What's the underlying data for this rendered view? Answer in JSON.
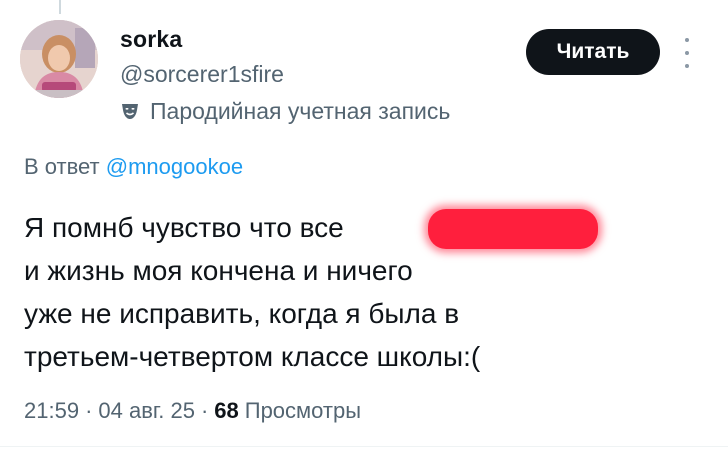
{
  "author": {
    "name": "sorka",
    "handle": "@sorcerer1sfire",
    "label": "Пародийная учетная запись",
    "label_icon": "theater-mask-icon"
  },
  "follow_button": {
    "label": "Читать"
  },
  "more_menu": {
    "icon": "more-vertical-icon"
  },
  "reply": {
    "prefix": "В ответ",
    "mention": "@mnogookoe"
  },
  "tweet": {
    "lines": [
      "Я помнб чувство что все",
      "и жизнь моя кончена и ничего",
      "уже не исправить, когда я была в",
      "третьем-четвертом классе школы:("
    ],
    "redaction_color": "#ff1f3d"
  },
  "meta": {
    "time": "21:59",
    "separator": "·",
    "date": "04 авг. 25",
    "views_count": "68",
    "views_label": "Просмотры"
  },
  "colors": {
    "text": "#0f1419",
    "secondary": "#536471",
    "link": "#1d9bf0",
    "button_bg": "#0f1419"
  }
}
